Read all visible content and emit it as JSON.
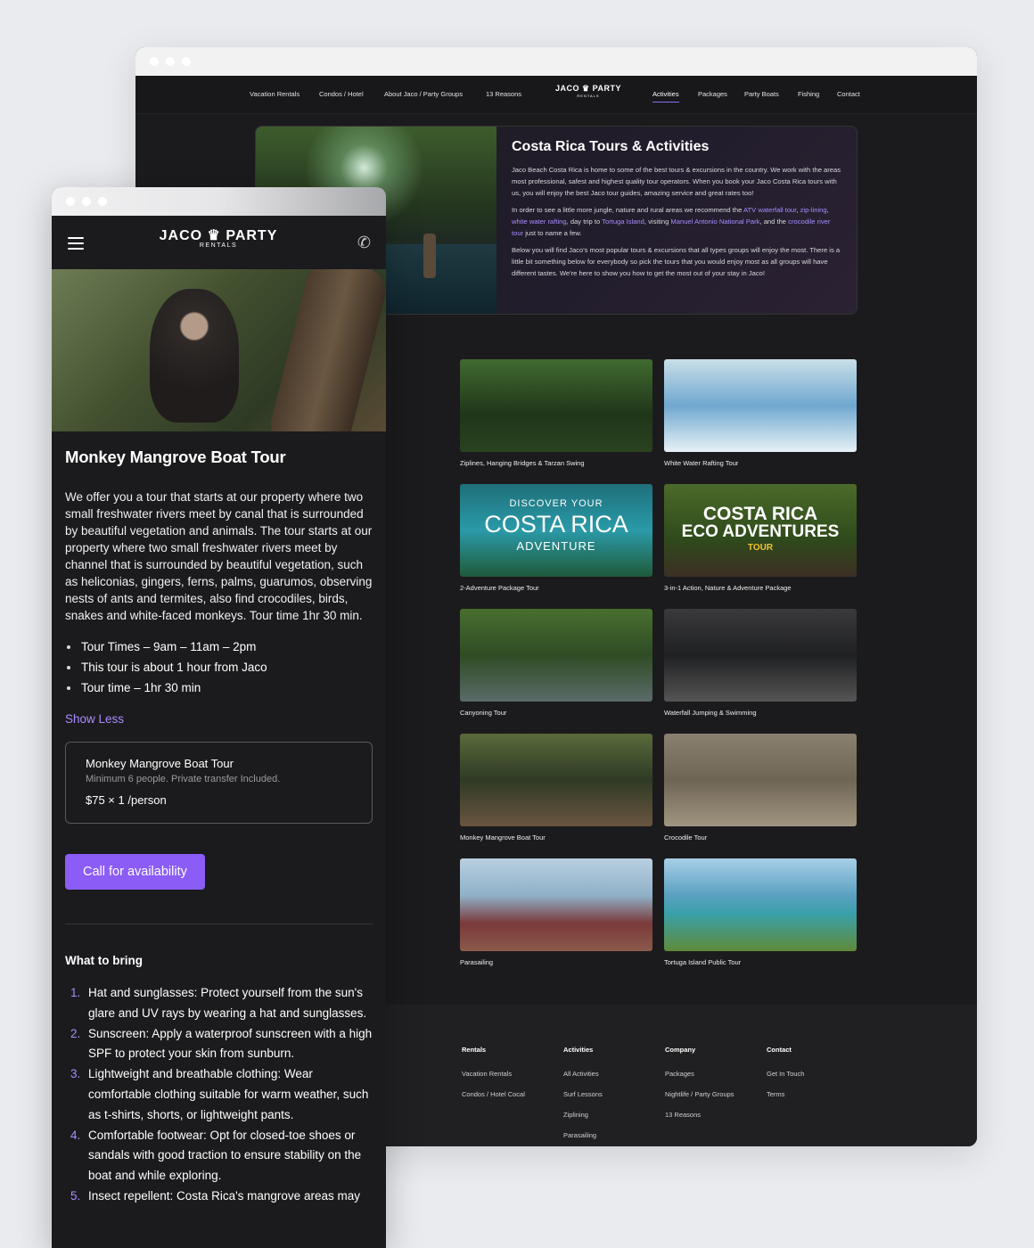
{
  "desktop": {
    "nav_left": [
      "Vacation Rentals",
      "Condos / Hotel",
      "About Jaco / Party Groups",
      "13 Reasons"
    ],
    "logo": {
      "left": "JACO",
      "right": "PARTY",
      "sub": "RENTALS"
    },
    "nav_right": [
      "Activities",
      "Packages",
      "Party Boats",
      "Fishing",
      "Contact"
    ],
    "active_nav": "Activities",
    "hero": {
      "title": "Costa Rica Tours & Activities",
      "p1": "Jaco Beach Costa Rica is home to some of the best tours & excursions in the country. We work with the areas most professional, safest and highest quality tour operators. When you book your Jaco Costa Rica tours with us, you will enjoy the best Jaco tour guides, amazing service and great rates too!",
      "p2_a": "In order to see a little more jungle, nature and rural areas we recommend the ",
      "p2_l1": "ATV waterfall tour",
      "p2_b": ", ",
      "p2_l2": "zip-lining",
      "p2_c": ", ",
      "p2_l3": "white water rafting",
      "p2_d": ", day trip to ",
      "p2_l4": "Tortuga Island",
      "p2_e": ", visiting ",
      "p2_l5": "Manuel Antonio National Park",
      "p2_f": ", and the ",
      "p2_l6": "crocodile river tour",
      "p2_g": " just to name a few.",
      "p3": "Below you will find Jaco's most popular tours & excursions that all types groups will enjoy the most. There is a little bit something below for everybody so pick the tours that you would enjoy most as all groups will have different tastes. We're here to show you how to get the most out of your stay in Jaco!"
    },
    "tours": [
      {
        "name": "Ziplines, Hanging Bridges & Tarzan Swing"
      },
      {
        "name": "White Water Rafting Tour"
      },
      {
        "name": "2-Adventure Package Tour",
        "overlay": [
          "DISCOVER YOUR",
          "COSTA RICA",
          "ADVENTURE"
        ]
      },
      {
        "name": "3-in-1 Action, Nature & Adventure Package",
        "overlay": [
          "COSTA RICA",
          "ECO ADVENTURES",
          "TOUR"
        ]
      },
      {
        "name": "Canyoning Tour"
      },
      {
        "name": "Waterfall Jumping & Swimming"
      },
      {
        "name": "Monkey Mangrove Boat Tour"
      },
      {
        "name": "Crocodile Tour"
      },
      {
        "name": "Parasailing"
      },
      {
        "name": "Tortuga Island Public Tour"
      }
    ],
    "footer": [
      {
        "title": "Rentals",
        "links": [
          "Vacation Rentals",
          "Condos / Hotel Cocal"
        ]
      },
      {
        "title": "Activities",
        "links": [
          "All Activities",
          "Surf Lessons",
          "Ziplining",
          "Parasailing"
        ]
      },
      {
        "title": "Company",
        "links": [
          "Packages",
          "Nightlife / Party Groups",
          "13 Reasons"
        ]
      },
      {
        "title": "Contact",
        "links": [
          "Get In Touch",
          "Terms"
        ]
      }
    ]
  },
  "mobile": {
    "logo": {
      "left": "JACO",
      "right": "PARTY",
      "sub": "RENTALS"
    },
    "title": "Monkey Mangrove Boat Tour",
    "description": "We offer you a tour that starts at our property where two small freshwater rivers meet by canal that is surrounded by beautiful vegetation and animals. The tour starts at our property where two small freshwater rivers meet by channel that is surrounded by beautiful vegetation, such as heliconias, gingers, ferns, palms, guarumos, observing nests of ants and termites, also find crocodiles, birds, snakes and white-faced monkeys. Tour time 1hr 30 min.",
    "bullets": [
      "Tour Times – 9am – 11am – 2pm",
      "This tour is about 1 hour from Jaco",
      "Tour time – 1hr 30 min"
    ],
    "show_less": "Show Less",
    "price_card": {
      "title": "Monkey Mangrove Boat Tour",
      "meta": "Minimum 6 people. Private transfer Included.",
      "price": "$75 × 1 /person"
    },
    "cta": "Call for availability",
    "what_to_bring_title": "What to bring",
    "what_to_bring": [
      "Hat and sunglasses: Protect yourself from the sun's glare and UV rays by wearing a hat and sunglasses.",
      "Sunscreen: Apply a waterproof sunscreen with a high SPF to protect your skin from sunburn.",
      "Lightweight and breathable clothing: Wear comfortable clothing suitable for warm weather, such as t-shirts, shorts, or lightweight pants.",
      "Comfortable footwear: Opt for closed-toe shoes or sandals with good traction to ensure stability on the boat and while exploring.",
      "Insect repellent: Costa Rica's mangrove areas may"
    ]
  },
  "colors": {
    "accent": "#8b5cf6",
    "link": "#a98cff",
    "background": "#1b1b1d",
    "page": "#e9ebef"
  }
}
